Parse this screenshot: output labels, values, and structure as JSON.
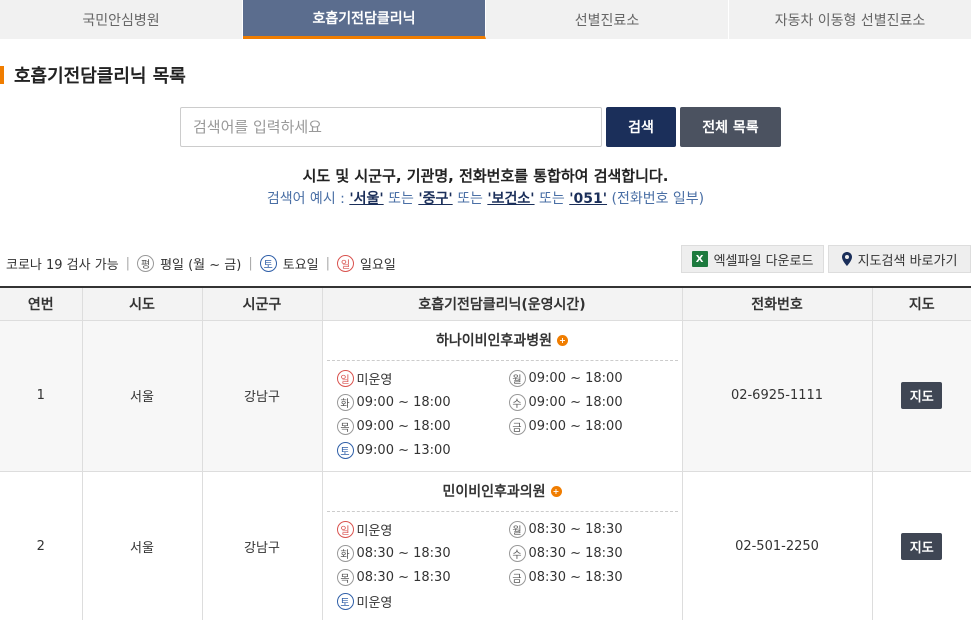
{
  "tabs": [
    {
      "label": "국민안심병원"
    },
    {
      "label": "호흡기전담클리닉",
      "active": true
    },
    {
      "label": "선별진료소"
    },
    {
      "label": "자동차 이동형 선별진료소"
    }
  ],
  "page_title": "호흡기전담클리닉 목록",
  "search": {
    "placeholder": "검색어를 입력하세요",
    "value": "",
    "search_label": "검색",
    "all_label": "전체 목록"
  },
  "description": {
    "line1": "시도 및 시군구, 기관명, 전화번호를 통합하여 검색합니다.",
    "prefix": "검색어 예시 : ",
    "ex1": "'서울'",
    "or1": " 또는 ",
    "ex2": "'중구'",
    "or2": " 또는 ",
    "ex3": "'보건소'",
    "or3": " 또는 ",
    "ex4": "'051'",
    "suffix": " (전화번호 일부)"
  },
  "legend": {
    "covid": "코로나 19 검사 가능",
    "weekday_glyph": "평",
    "weekday": "평일 (월 ~ 금)",
    "sat_glyph": "토",
    "sat": "토요일",
    "sun_glyph": "일",
    "sun": "일요일"
  },
  "actions": {
    "excel_icon": "X",
    "excel": "엑셀파일 다운로드",
    "map": "지도검색 바로가기"
  },
  "table": {
    "headers": [
      "연번",
      "시도",
      "시군구",
      "호흡기전담클리닉(운영시간)",
      "전화번호",
      "지도"
    ],
    "map_label": "지도",
    "rows": [
      {
        "no": "1",
        "sido": "서울",
        "sigungu": "강남구",
        "name": "하나이비인후과병원",
        "hours": [
          {
            "glyph": "일",
            "time": "미운영"
          },
          {
            "glyph": "월",
            "time": "09:00 ~ 18:00"
          },
          {
            "glyph": "화",
            "time": "09:00 ~ 18:00"
          },
          {
            "glyph": "수",
            "time": "09:00 ~ 18:00"
          },
          {
            "glyph": "목",
            "time": "09:00 ~ 18:00"
          },
          {
            "glyph": "금",
            "time": "09:00 ~ 18:00"
          },
          {
            "glyph": "토",
            "time": "09:00 ~ 13:00"
          }
        ],
        "phone": "02-6925-1111"
      },
      {
        "no": "2",
        "sido": "서울",
        "sigungu": "강남구",
        "name": "민이비인후과의원",
        "hours": [
          {
            "glyph": "일",
            "time": "미운영"
          },
          {
            "glyph": "월",
            "time": "08:30 ~ 18:30"
          },
          {
            "glyph": "화",
            "time": "08:30 ~ 18:30"
          },
          {
            "glyph": "수",
            "time": "08:30 ~ 18:30"
          },
          {
            "glyph": "목",
            "time": "08:30 ~ 18:30"
          },
          {
            "glyph": "금",
            "time": "08:30 ~ 18:30"
          },
          {
            "glyph": "토",
            "time": "미운영"
          }
        ],
        "phone": "02-501-2250"
      }
    ]
  },
  "colors": {
    "tab_active": "#5b6d8e",
    "accent": "#f07d00",
    "navy": "#1b2f5a",
    "sunday": "#d9534f",
    "saturday": "#2f5fa8"
  }
}
